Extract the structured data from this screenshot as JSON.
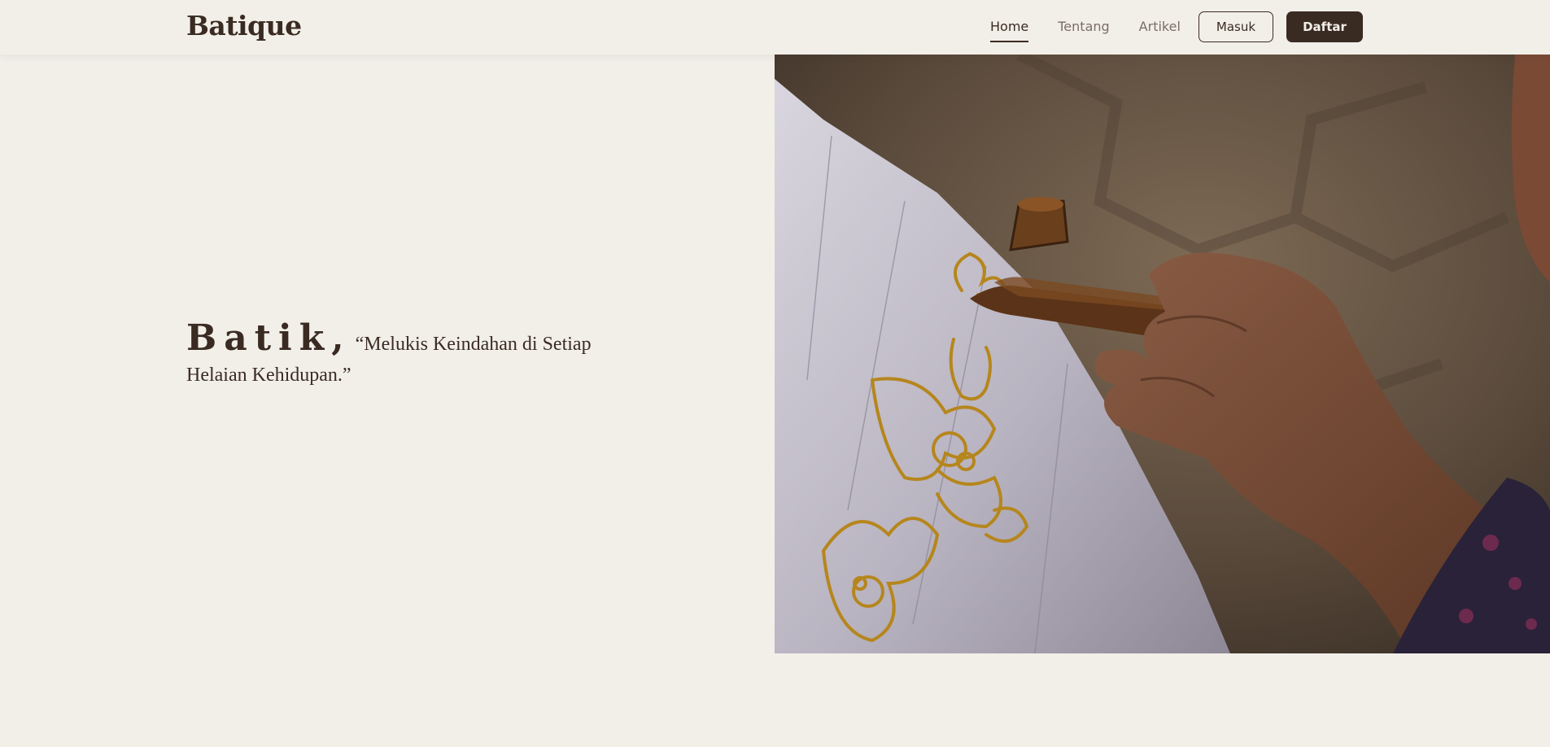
{
  "brand": {
    "name": "Batique"
  },
  "nav": {
    "links": [
      {
        "label": "Home",
        "active": true
      },
      {
        "label": "Tentang",
        "active": false
      },
      {
        "label": "Artikel",
        "active": false
      }
    ],
    "login_label": "Masuk",
    "register_label": "Daftar"
  },
  "hero": {
    "word": "Batik,",
    "quote": "“Melukis Keindahan di Setiap Helaian Kehidupan.”"
  },
  "colors": {
    "background": "#f2efe9",
    "accent_dark": "#3a2b22",
    "nav_inactive": "#7a6e67"
  }
}
